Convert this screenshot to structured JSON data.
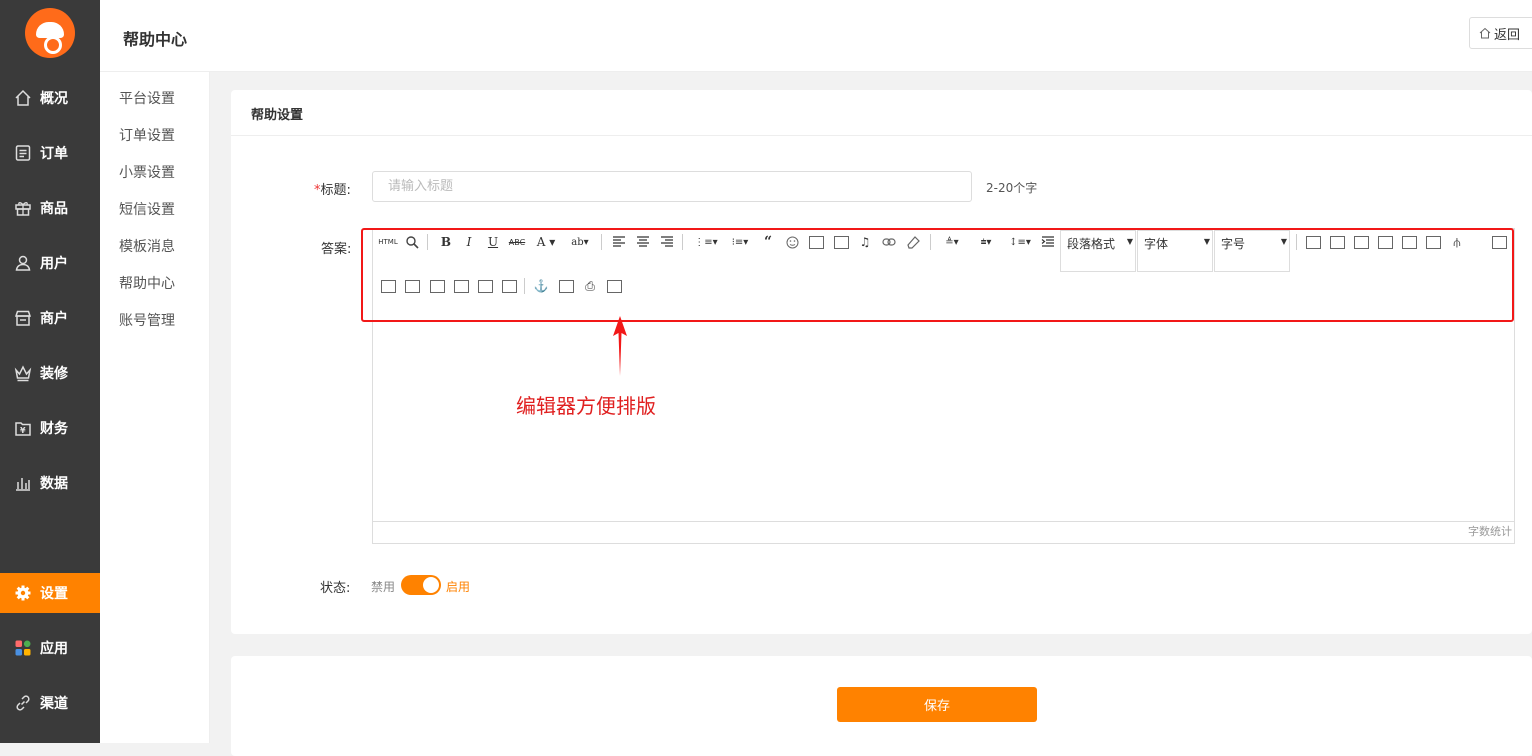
{
  "sidebar": {
    "items": [
      {
        "label": "概况",
        "icon": "home-icon"
      },
      {
        "label": "订单",
        "icon": "order-icon"
      },
      {
        "label": "商品",
        "icon": "gift-icon"
      },
      {
        "label": "用户",
        "icon": "user-icon"
      },
      {
        "label": "商户",
        "icon": "store-icon"
      },
      {
        "label": "装修",
        "icon": "crown-icon"
      },
      {
        "label": "财务",
        "icon": "finance-icon"
      },
      {
        "label": "数据",
        "icon": "chart-icon"
      },
      {
        "label": "设置",
        "icon": "gear-icon",
        "active": true
      },
      {
        "label": "应用",
        "icon": "apps-icon"
      },
      {
        "label": "渠道",
        "icon": "link-icon"
      }
    ]
  },
  "header": {
    "title": "帮助中心",
    "back_label": "返回"
  },
  "submenu": {
    "items": [
      "平台设置",
      "订单设置",
      "小票设置",
      "短信设置",
      "模板消息",
      "帮助中心",
      "账号管理"
    ]
  },
  "card": {
    "title": "帮助设置",
    "title_field": {
      "required_mark": "*",
      "label": "标题:",
      "placeholder": "请输入标题",
      "hint": "2-20个字"
    },
    "answer_label": "答案:",
    "editor": {
      "combos": [
        "段落格式",
        "字体",
        "字号"
      ],
      "word_count": "字数统计"
    },
    "status": {
      "label": "状态:",
      "off": "禁用",
      "on": "启用",
      "value": true
    }
  },
  "annotation": "编辑器方便排版",
  "save_label": "保存",
  "colors": {
    "accent": "#ff8200",
    "highlight": "#f21818",
    "sidebar": "#3a3a3a"
  }
}
